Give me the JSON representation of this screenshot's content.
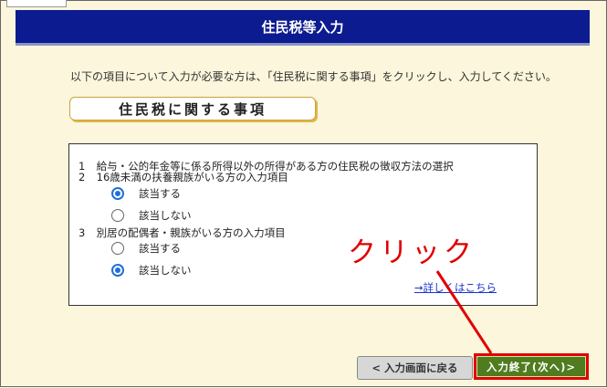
{
  "header": {
    "title": "住民税等入力"
  },
  "instruction": "以下の項目について入力が必要な方は、「住民税に関する事項」をクリックし、入力してください。",
  "section_button": "住民税に関する事項",
  "panel": {
    "item1": {
      "num": "1",
      "text": "給与・公的年金等に係る所得以外の所得がある方の住民税の徴収方法の選択"
    },
    "item2": {
      "num": "2",
      "text": "16歳未満の扶養親族がいる方の入力項目"
    },
    "item2_options": {
      "yes": "該当する",
      "no": "該当しない",
      "selected": "該当する"
    },
    "item3": {
      "num": "3",
      "text": "別居の配偶者・親族がいる方の入力項目"
    },
    "item3_options": {
      "yes": "該当する",
      "no": "該当しない",
      "selected": "該当しない"
    },
    "detail_link": "→詳しくはこちら"
  },
  "annotation": {
    "text": "クリック",
    "color": "#e00000"
  },
  "buttons": {
    "back": "< 入力画面に戻る",
    "next": "入力終了(次へ)>"
  },
  "colors": {
    "header_bg": "#0c1b8f",
    "next_bg": "#4f7c1e",
    "highlight": "#e00000",
    "page_bg": "#fbf6dc"
  }
}
